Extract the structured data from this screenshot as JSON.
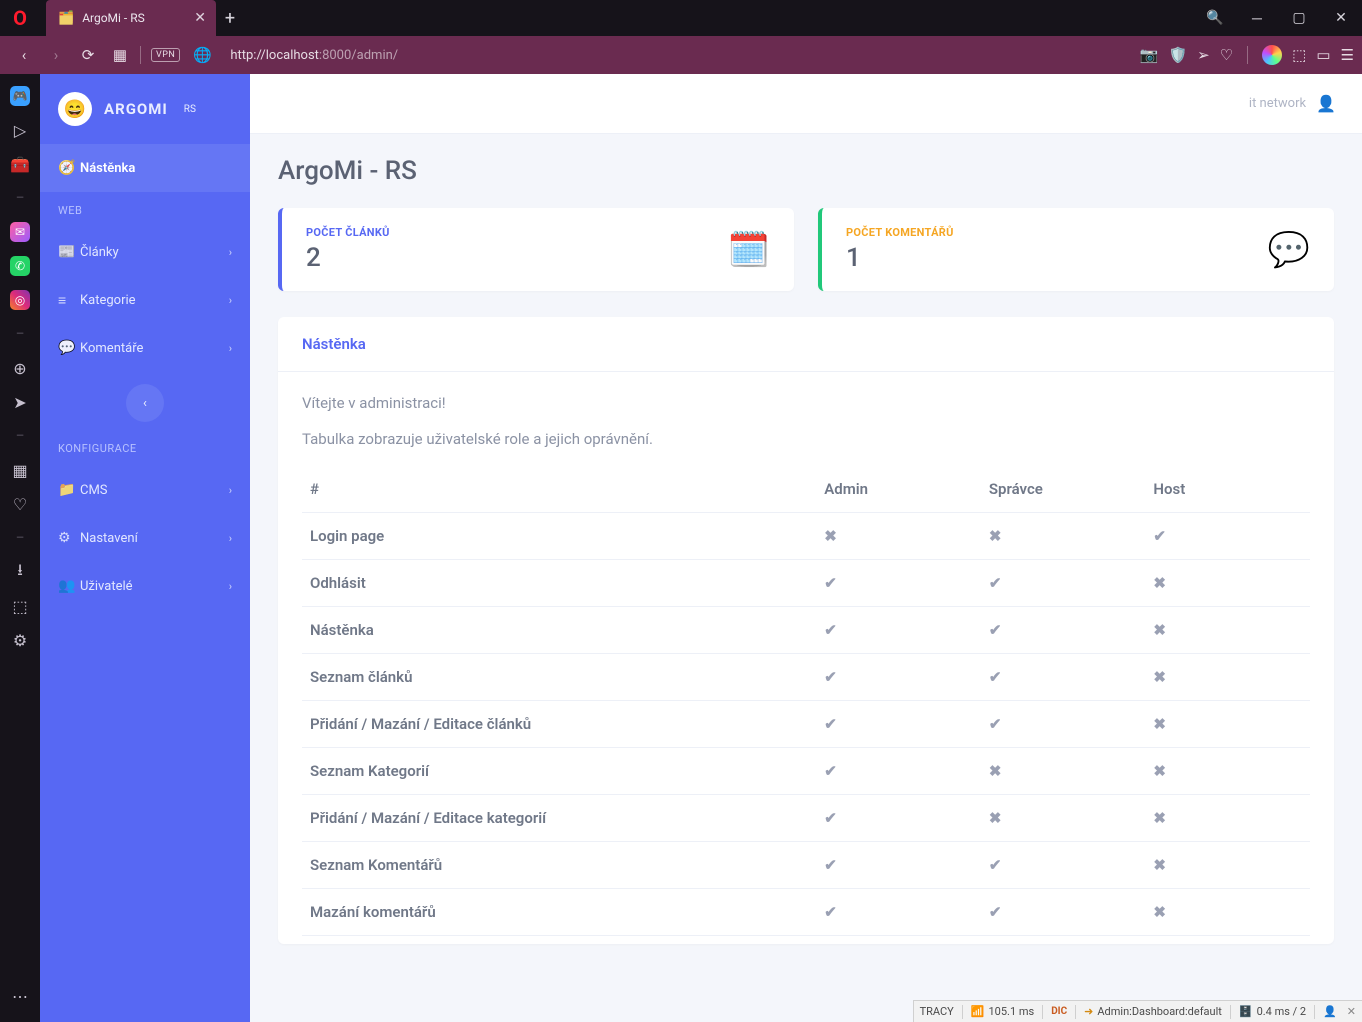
{
  "browser": {
    "tab_title": "ArgoMi - RS",
    "url_host": "http://localhost",
    "url_rest": ":8000/admin/",
    "vpn": "VPN"
  },
  "brand": {
    "name": "ARGOMI",
    "sup": "RS"
  },
  "sidebar": {
    "dashboard": "Nástěnka",
    "section_web": "WEB",
    "articles": "Články",
    "categories": "Kategorie",
    "comments": "Komentáře",
    "section_config": "KONFIGURACE",
    "cms": "CMS",
    "settings": "Nastavení",
    "users": "Uživatelé"
  },
  "topbar": {
    "user": "it network"
  },
  "page": {
    "title": "ArgoMi - RS"
  },
  "cards": {
    "articles_label": "POČET ČLÁNKŮ",
    "articles_value": "2",
    "comments_label": "POČET KOMENTÁŘŮ",
    "comments_value": "1"
  },
  "panel": {
    "title": "Nástěnka",
    "lead1": "Vítejte v administraci!",
    "lead2": "Tabulka zobrazuje uživatelské role a jejich oprávnění."
  },
  "table": {
    "head": [
      "#",
      "Admin",
      "Správce",
      "Host"
    ],
    "rows": [
      {
        "name": "Login page",
        "admin": false,
        "spravce": false,
        "host": true
      },
      {
        "name": "Odhlásit",
        "admin": true,
        "spravce": true,
        "host": false
      },
      {
        "name": "Nástěnka",
        "admin": true,
        "spravce": true,
        "host": false
      },
      {
        "name": "Seznam článků",
        "admin": true,
        "spravce": true,
        "host": false
      },
      {
        "name": "Přidání / Mazání / Editace článků",
        "admin": true,
        "spravce": true,
        "host": false
      },
      {
        "name": "Seznam Kategorií",
        "admin": true,
        "spravce": false,
        "host": false
      },
      {
        "name": "Přidání / Mazání / Editace kategorií",
        "admin": true,
        "spravce": false,
        "host": false
      },
      {
        "name": "Seznam Komentářů",
        "admin": true,
        "spravce": true,
        "host": false
      },
      {
        "name": "Mazání komentářů",
        "admin": true,
        "spravce": true,
        "host": false
      }
    ]
  },
  "tracy": {
    "brand": "TRACY",
    "time": "105.1 ms",
    "dic": "DIC",
    "route": "Admin:Dashboard:default",
    "db": "0.4 ms / 2"
  },
  "chart_data": {
    "type": "table",
    "title": "Uživatelské role a jejich oprávnění",
    "columns": [
      "#",
      "Admin",
      "Správce",
      "Host"
    ],
    "rows": [
      [
        "Login page",
        false,
        false,
        true
      ],
      [
        "Odhlásit",
        true,
        true,
        false
      ],
      [
        "Nástěnka",
        true,
        true,
        false
      ],
      [
        "Seznam článků",
        true,
        true,
        false
      ],
      [
        "Přidání / Mazání / Editace článků",
        true,
        true,
        false
      ],
      [
        "Seznam Kategorií",
        true,
        false,
        false
      ],
      [
        "Přidání / Mazání / Editace kategorií",
        true,
        false,
        false
      ],
      [
        "Seznam Komentářů",
        true,
        true,
        false
      ],
      [
        "Mazání komentářů",
        true,
        true,
        false
      ]
    ]
  }
}
